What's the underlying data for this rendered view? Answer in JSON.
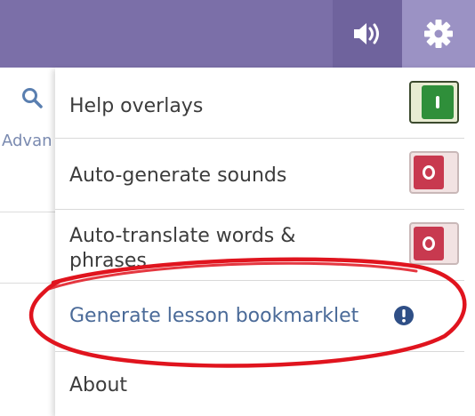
{
  "header": {
    "sound_icon": "volume-icon",
    "settings_icon": "gear-icon"
  },
  "background_page": {
    "search_icon": "search-icon",
    "advanced_text": "Advan"
  },
  "menu": {
    "items": [
      {
        "label": "Help overlays",
        "toggle": "on"
      },
      {
        "label": "Auto-generate sounds",
        "toggle": "off"
      },
      {
        "label_line1": "Auto-translate words &",
        "label_line2": "phrases",
        "toggle": "off"
      },
      {
        "label": "Generate lesson bookmarklet",
        "icon": "exclamation-circle-icon"
      },
      {
        "label": "About"
      }
    ]
  },
  "colors": {
    "header_bg": "#7b6fa8",
    "gear_bg": "#9b92c4",
    "toggle_on": "#2f8f3a",
    "toggle_off": "#c8394f",
    "link_text": "#4a6a98",
    "annotation": "#e0141e"
  }
}
